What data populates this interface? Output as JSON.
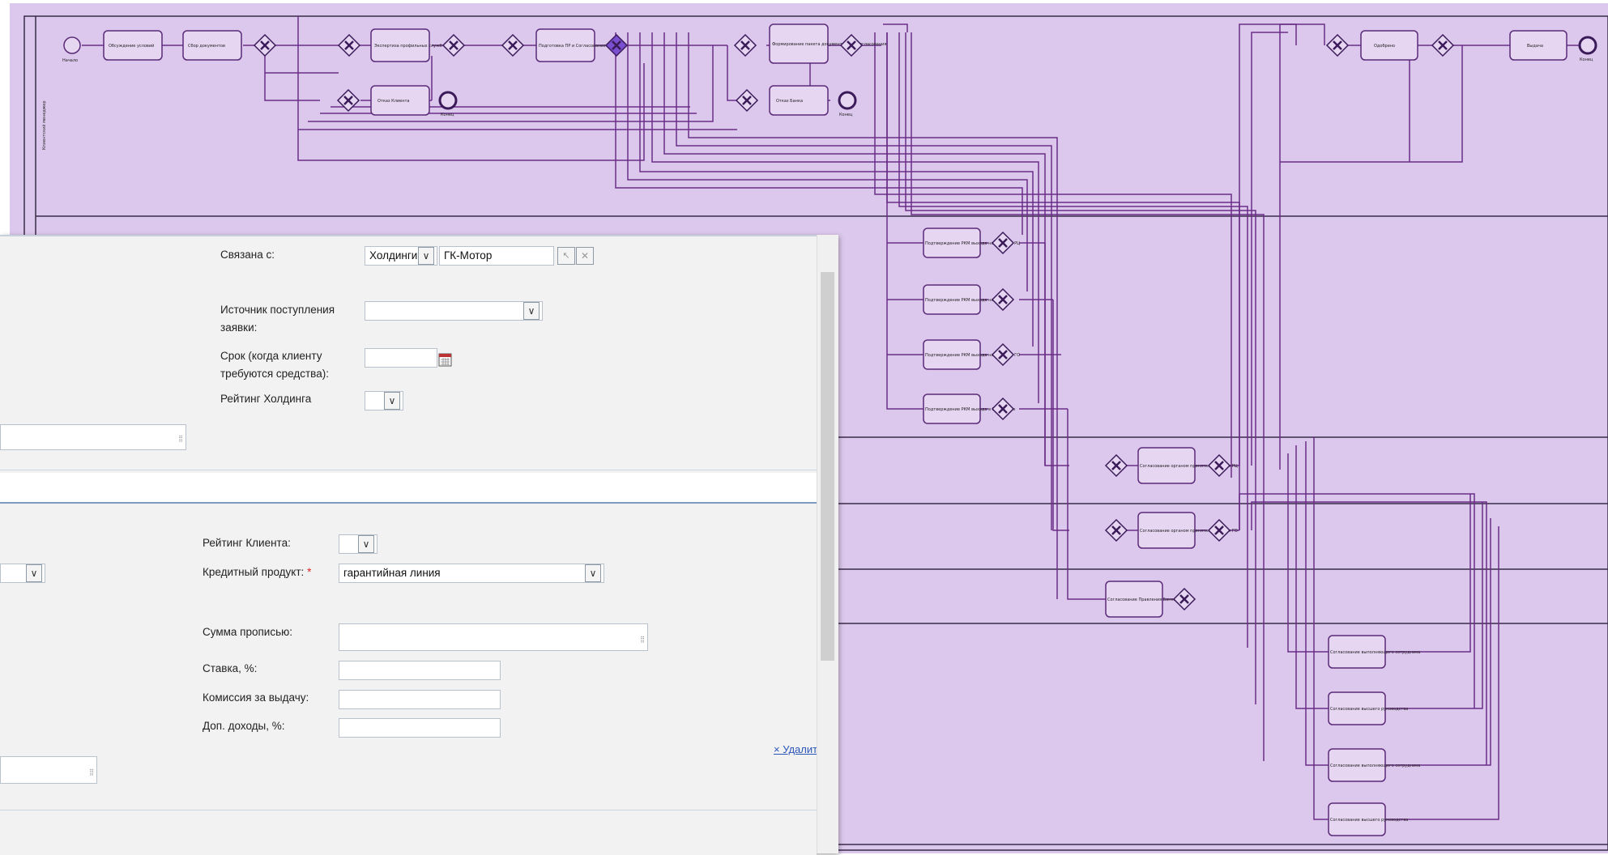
{
  "diagram": {
    "lane_label": "Клиентский менеджер",
    "nodes": {
      "start": "Начало",
      "discuss": "Обсуждение условий",
      "collect": "Сбор документов",
      "expert": "Экспертиза профильных служб",
      "prepare": "Подготовка ПР и Согласование СРО",
      "form_pkg": "Формирование пакета документов для согласования",
      "client_refusal": "Отказ Клиента",
      "bank_refusal": "Отказ Банка",
      "end1": "Конец",
      "end2": "Конец",
      "approve": "Одобрено",
      "issue": "Выдача",
      "end3": "Конец",
      "rm1": "Подтверждение РКМ выхода на Комитет РЦ",
      "rm2": "Подтверждение РКМ выхода на Комитет",
      "rm3": "Подтверждение РКМ выхода на Комитет ГО",
      "rm4": "Подтверждение РКМ выхода в Правление",
      "agree_rc": "Согласование органом принятия решения РЦ",
      "agree_go": "Согласование органом принятия решения ГО",
      "agree_board": "Согласование Правления Банка",
      "agree_a": "Согласование выполняющего сотрудника",
      "agree_b": "Согласование высшего руководства",
      "agree_c": "Согласование выполняющего сотрудника",
      "agree_d": "Согласование высшего руководства"
    },
    "colors": {
      "background": "#dcc8ec",
      "lines": "#6a2d86",
      "node_fill": "#e6d6f2",
      "node_stroke": "#5a2a78",
      "swimlane": "#3a2a48",
      "active_gateway": "#7a4fd0"
    }
  },
  "form": {
    "top": {
      "linked_label": "Связана с:",
      "linked_type": "Холдинги",
      "linked_value": "ГК-Мотор",
      "source_label": "Источник поступления заявки:",
      "source_value": "",
      "deadline_label": "Срок (когда клиенту требуются средства):",
      "deadline_value": "",
      "holding_rating_label": "Рейтинг Холдинга",
      "holding_rating_value": ""
    },
    "bottom": {
      "delete_link": "× Удалить",
      "client_rating_label": "Рейтинг Клиента:",
      "client_rating_value": "",
      "credit_product_label": "Кредитный продукт:",
      "required_mark": "*",
      "credit_product_value": "гарантийная линия",
      "amount_words_label": "Сумма прописью:",
      "rate_label": "Ставка, %:",
      "fee_label": "Комиссия за выдачу:",
      "extra_income_label": "Доп. доходы, %:"
    },
    "icons": {
      "dropdown": "chevron-down-icon",
      "calendar": "calendar-icon",
      "select_pointer": "pointer-icon",
      "clear": "close-icon",
      "resize": "resize-grip-icon"
    }
  }
}
